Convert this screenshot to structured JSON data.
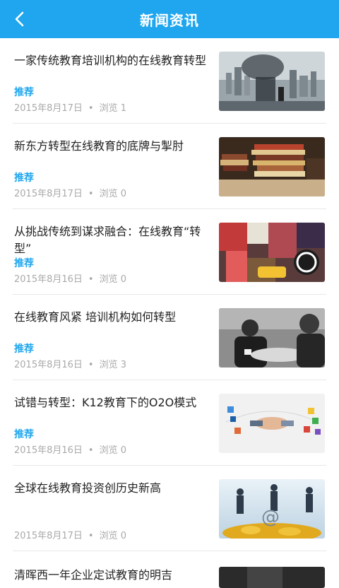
{
  "header": {
    "title": "新闻资讯"
  },
  "articles": [
    {
      "title": "一家传统教育培训机构的在线教育转型",
      "tag": "推荐",
      "date": "2015年8月17日",
      "views_label": "浏览 1",
      "image": "city-businessman-photo"
    },
    {
      "title": "新东方转型在线教育的底牌与掣肘",
      "tag": "推荐",
      "date": "2015年8月17日",
      "views_label": "浏览 0",
      "image": "book-stack-photo"
    },
    {
      "title": "从挑战传统到谋求融合：在线教育“转型”",
      "tag": "推荐",
      "date": "2015年8月16日",
      "views_label": "浏览 0",
      "image": "street-storefront-photo"
    },
    {
      "title": "在线教育风紧 培训机构如何转型",
      "tag": "推荐",
      "date": "2015年8月16日",
      "views_label": "浏览 3",
      "image": "meeting-photo"
    },
    {
      "title": "试错与转型：K12教育下的O2O模式",
      "tag": "推荐",
      "date": "2015年8月16日",
      "views_label": "浏览 0",
      "image": "handshake-apps-illustration"
    },
    {
      "title": "全球在线教育投资创历史新高",
      "tag": "",
      "date": "2015年8月17日",
      "views_label": "浏览 0",
      "image": "investors-coins-illustration"
    },
    {
      "title": "清晖西一年企业定试教育的明吉",
      "tag": "",
      "date": "",
      "views_label": "",
      "image": "dark-photo"
    }
  ],
  "meta_separator": "•"
}
